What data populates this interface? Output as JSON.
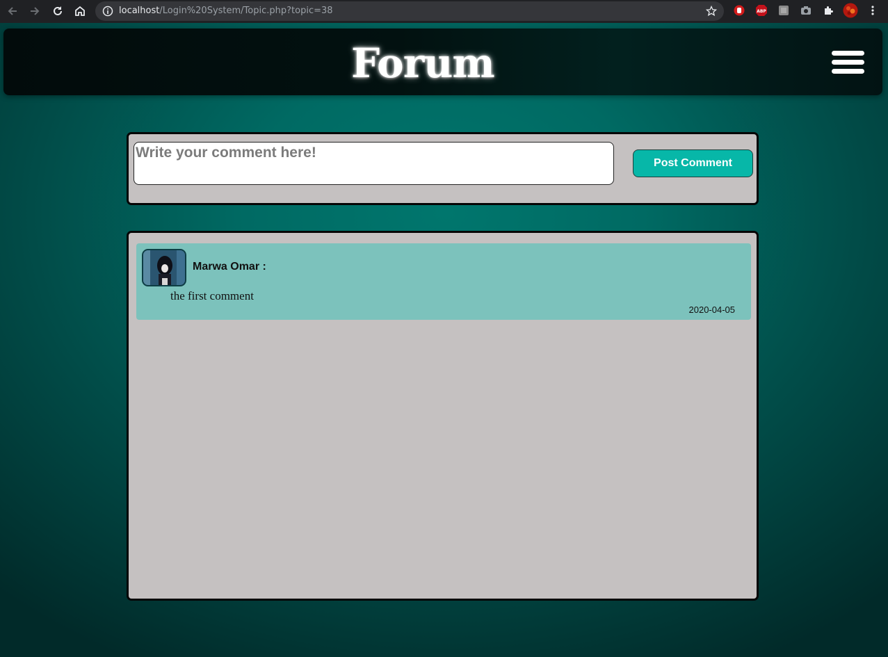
{
  "browser": {
    "url_host": "localhost",
    "url_path": "/Login%20System/Topic.php?topic=38",
    "extensions": [
      "hand-stop-icon",
      "adblock-plus-icon",
      "extension-square-icon",
      "camera-icon",
      "puzzle-icon",
      "profile-avatar-icon"
    ],
    "adblock_label": "ABP"
  },
  "header": {
    "logo": "Forum"
  },
  "composer": {
    "placeholder": "Write your comment here!",
    "post_label": "Post Comment"
  },
  "comments": [
    {
      "author": "Marwa Omar :",
      "text": "the first comment",
      "date": "2020-04-05"
    }
  ],
  "colors": {
    "accent": "#07b7a8",
    "comment_card": "#7cc2bc",
    "panel": "#c5c1c1",
    "header": "#021110"
  }
}
